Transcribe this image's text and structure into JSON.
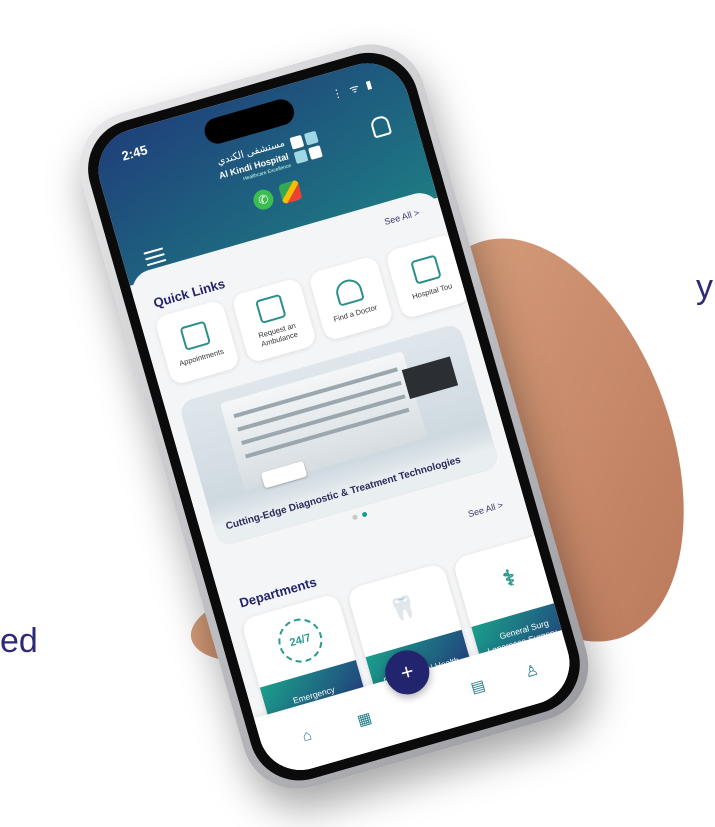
{
  "marketing": {
    "fragment_top": "y",
    "fragment_bottom": "ed"
  },
  "status_bar": {
    "time": "2:45",
    "icons": "⋮ ᯤ ▮"
  },
  "header": {
    "hospital_name_ar": "مستشفى الكندي",
    "hospital_name_en": "Al Kindi Hospital",
    "tagline": "Healthcare Excellence",
    "whatsapp_glyph": "✆"
  },
  "quick_links": {
    "title": "Quick Links",
    "see_all": "See All >",
    "items": [
      {
        "label": "Appointments",
        "icon": "calendar-icon"
      },
      {
        "label": "Request an Ambulance",
        "icon": "ambulance-icon"
      },
      {
        "label": "Find a Doctor",
        "icon": "doctor-icon"
      },
      {
        "label": "Hospital Tou",
        "icon": "hospital-icon"
      }
    ]
  },
  "banner": {
    "caption": "Cutting-Edge Diagnostic & Treatment Technologies",
    "slides": 2,
    "active_slide": 2
  },
  "departments": {
    "title": "Departments",
    "see_all": "See All >",
    "items": [
      {
        "label": "Emergency Department",
        "icon": "24-7-icon",
        "glyph": "24/7"
      },
      {
        "label": "Dental & Oral Health",
        "icon": "tooth-icon",
        "glyph": "🦷"
      },
      {
        "label": "General Surg Laparosco Surgery, & Su",
        "icon": "surgeon-icon",
        "glyph": "⚕"
      }
    ]
  },
  "bottom_nav": {
    "home": "⌂",
    "calendar": "▦",
    "add": "+",
    "hospital": "▤",
    "profile": "♙"
  },
  "colors": {
    "header_start": "#1f3f7a",
    "header_end": "#1e7b83",
    "accent": "#1a9f8b",
    "navy": "#23246e"
  }
}
